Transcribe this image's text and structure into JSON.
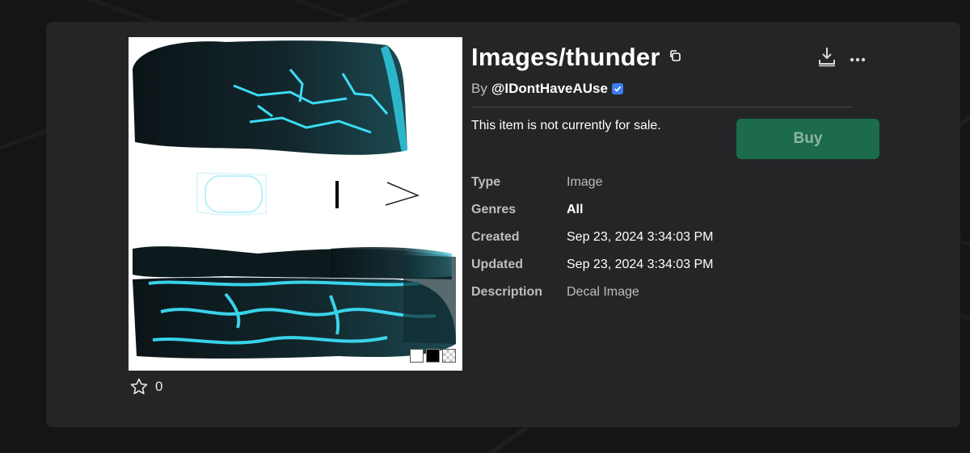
{
  "asset": {
    "title": "Images/thunder",
    "by_label": "By",
    "creator": "@IDontHaveAUse",
    "favorites_count": "0",
    "sale_note": "This item is not currently for sale.",
    "buy_label": "Buy"
  },
  "details": [
    {
      "label": "Type",
      "value": "Image"
    },
    {
      "label": "Genres",
      "value": "All"
    },
    {
      "label": "Created",
      "value": "Sep 23, 2024 3:34:03 PM"
    },
    {
      "label": "Updated",
      "value": "Sep 23, 2024 3:34:03 PM"
    },
    {
      "label": "Description",
      "value": "Decal Image"
    }
  ],
  "icons": {
    "copy": "copy-icon",
    "download": "download-icon",
    "more": "more-options-icon",
    "verified": "verified-badge-icon",
    "favorite": "star-outline-icon"
  },
  "colors": {
    "card": "#232527",
    "buy_button": "#1b6b4c",
    "verified": "#3b7cf2",
    "accent_cyan": "#3ee6ff"
  }
}
